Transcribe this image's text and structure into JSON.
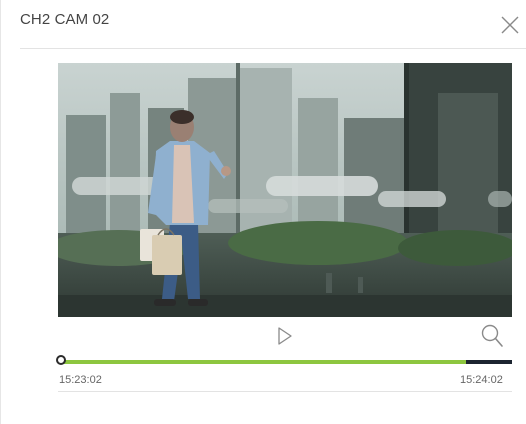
{
  "dialog": {
    "title": "CH2 CAM 02",
    "close_icon": "close-icon"
  },
  "video": {
    "description_icon": "video-frame"
  },
  "controls": {
    "play_icon": "play-icon",
    "zoom_icon": "search-icon"
  },
  "timeline": {
    "start_time": "15:23:02",
    "end_time": "15:24:02",
    "position_fraction": 0.0,
    "recorded_fraction": 0.897,
    "colors": {
      "recorded": "#8dc63f",
      "unrecorded": "#1c2430"
    }
  }
}
